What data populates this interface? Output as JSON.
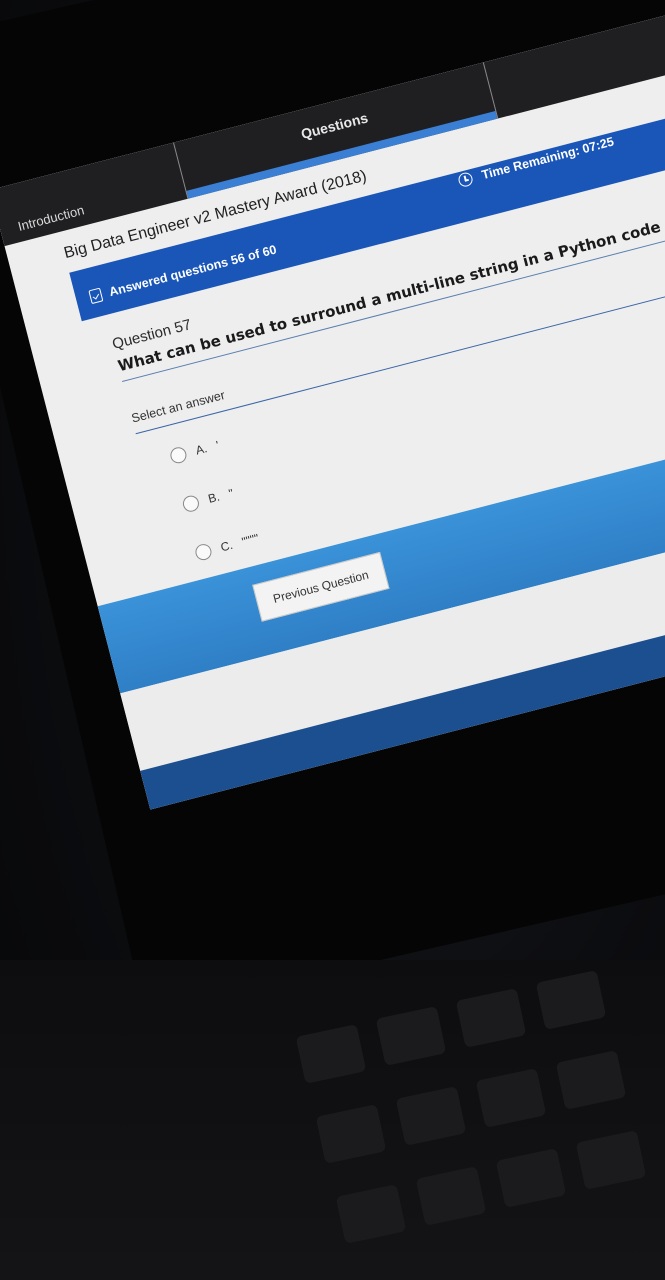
{
  "tabs": {
    "introduction": "Introduction",
    "questions": "Questions"
  },
  "course_title": "Big Data Engineer v2 Mastery Award (2018)",
  "status": {
    "answered": "Answered questions 56 of 60",
    "time_remaining": "Time Remaining: 07:25"
  },
  "question": {
    "number": "Question 57",
    "text": "What can be used to surround a multi-line string in a Python code"
  },
  "answers": {
    "prompt": "Select an answer",
    "options": [
      {
        "letter": "A.",
        "value": "'"
      },
      {
        "letter": "B.",
        "value": "\""
      },
      {
        "letter": "C.",
        "value": "\"\"\"\""
      }
    ]
  },
  "navigation": {
    "previous": "Previous Question"
  },
  "colors": {
    "status_bar": "#1a56b8",
    "band": "#3a92d8",
    "tab_active_indicator": "#3b7fd4"
  }
}
